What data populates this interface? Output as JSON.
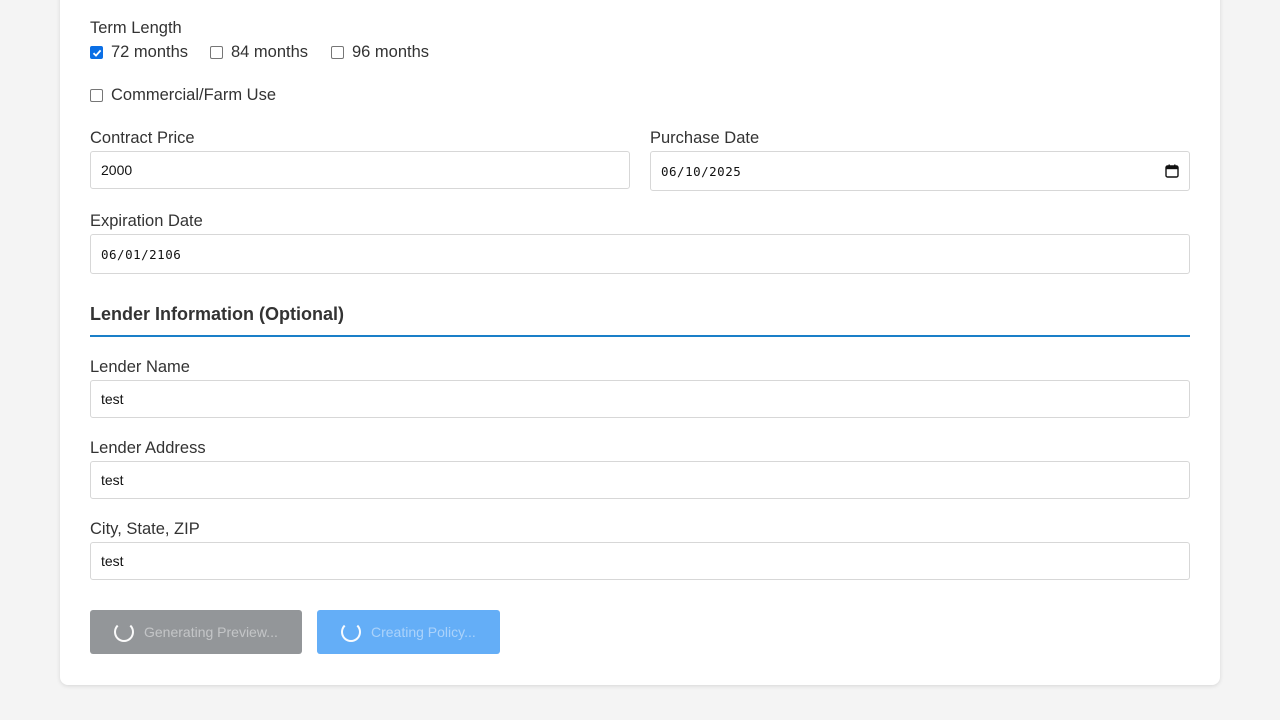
{
  "term": {
    "label": "Term Length",
    "options": [
      {
        "label": "72 months",
        "checked": true
      },
      {
        "label": "84 months",
        "checked": false
      },
      {
        "label": "96 months",
        "checked": false
      }
    ]
  },
  "commercial": {
    "label": "Commercial/Farm Use",
    "checked": false
  },
  "contract_price": {
    "label": "Contract Price",
    "value": "2000"
  },
  "purchase_date": {
    "label": "Purchase Date",
    "value": "06/10/2025"
  },
  "expiration_date": {
    "label": "Expiration Date",
    "value": "06/01/2106"
  },
  "lender_section": {
    "title": "Lender Information (Optional)"
  },
  "lender_name": {
    "label": "Lender Name",
    "value": "test"
  },
  "lender_address": {
    "label": "Lender Address",
    "value": "test"
  },
  "city_state_zip": {
    "label": "City, State, ZIP",
    "value": "test"
  },
  "buttons": {
    "preview_label": "Generating Preview...",
    "create_label": "Creating Policy..."
  },
  "colors": {
    "accent": "#0b6fe5",
    "rule": "#1a7fc8",
    "preview_btn": "#939699",
    "create_btn": "#64aef7"
  }
}
